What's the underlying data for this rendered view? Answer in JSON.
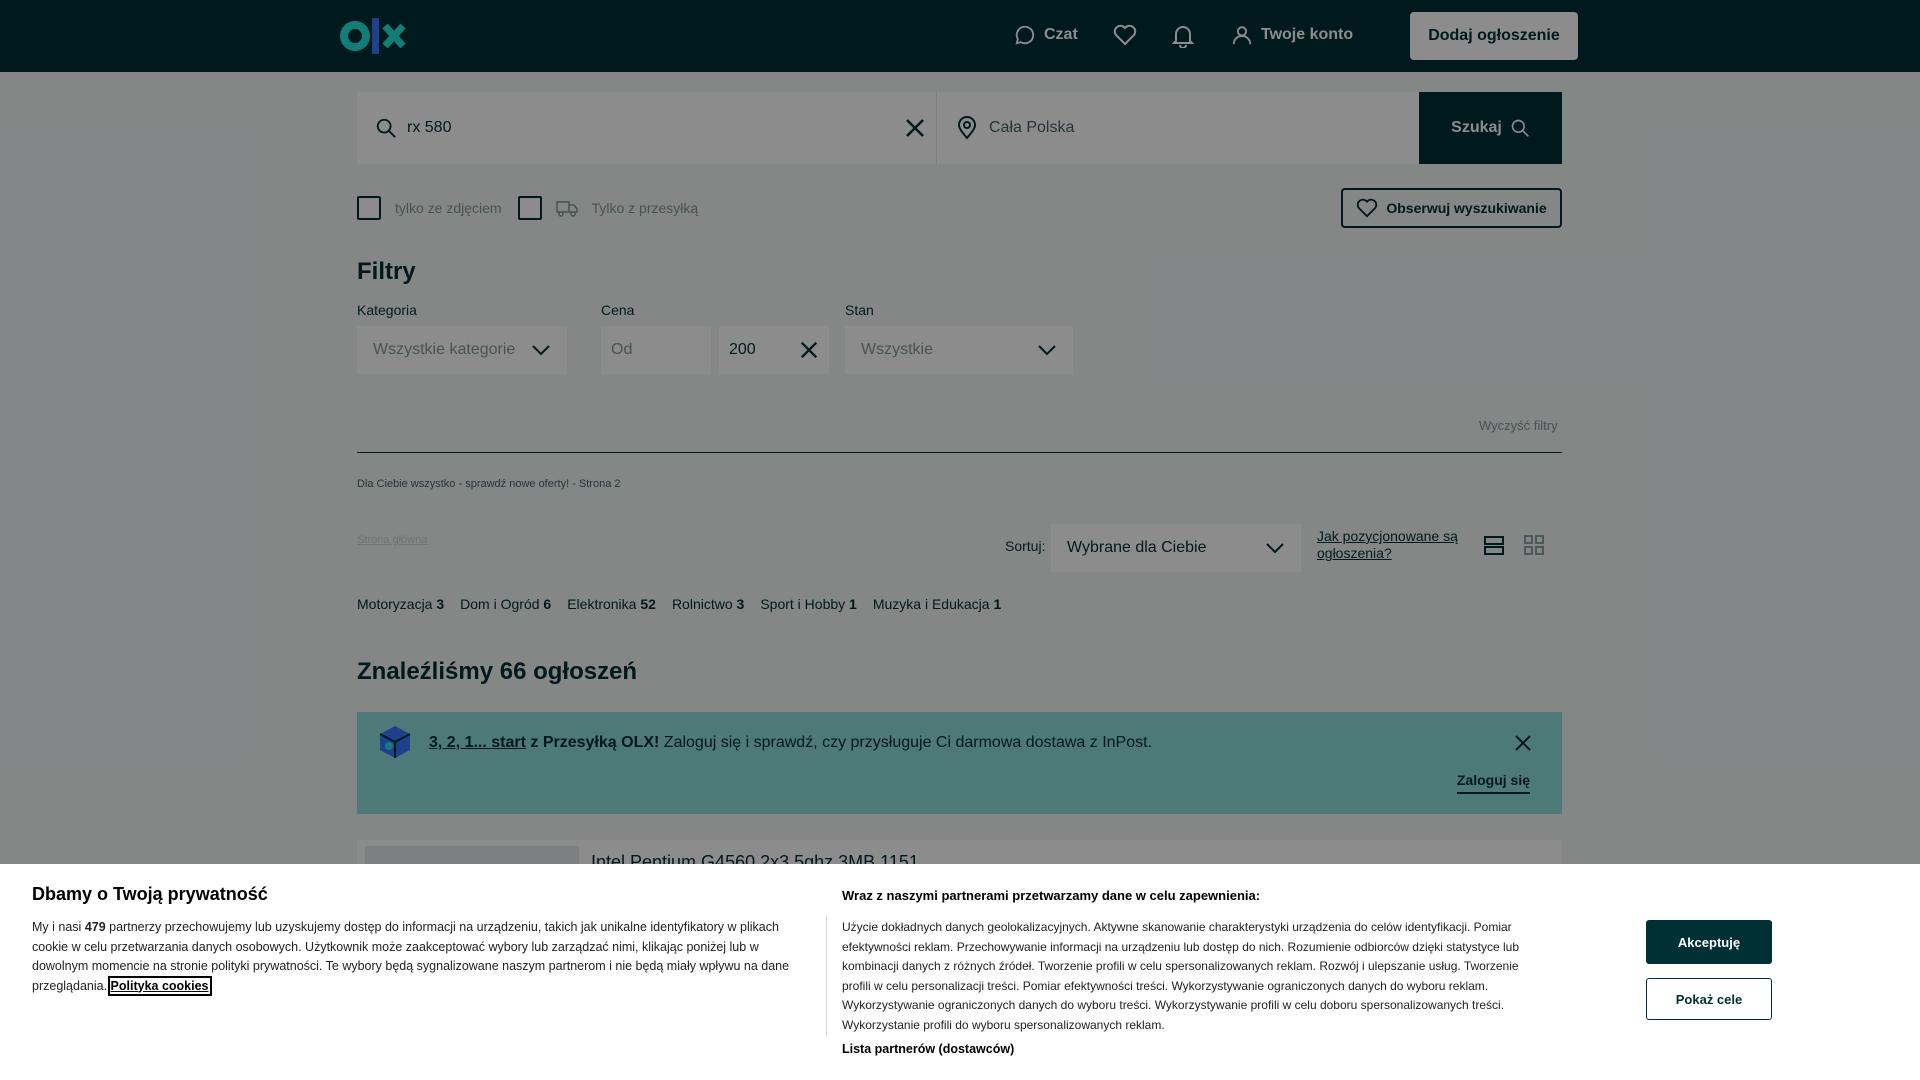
{
  "header": {
    "logo_text": "olx",
    "chat_label": "Czat",
    "account_label": "Twoje konto",
    "add_listing_label": "Dodaj ogłoszenie"
  },
  "search": {
    "query": "rx 580",
    "location": "Cała Polska",
    "button_label": "Szukaj"
  },
  "checkboxes": {
    "photo_only": "tylko ze zdjęciem",
    "shipping_only": "Tylko z przesyłką"
  },
  "observe_label": "Obserwuj wyszukiwanie",
  "filters": {
    "title": "Filtry",
    "category_label": "Kategoria",
    "category_value": "Wszystkie kategorie",
    "price_label": "Cena",
    "price_from_placeholder": "Od",
    "price_to_value": "200",
    "condition_label": "Stan",
    "condition_value": "Wszystkie",
    "clear_label": "Wyczyść filtry"
  },
  "breadcrumb_text": "Dla Ciebie wszystko - sprawdź nowe oferty! - Strona 2",
  "faint_link": "Strona główna",
  "sort": {
    "label": "Sortuj:",
    "value": "Wybrane dla Ciebie",
    "positioning_link": "Jak pozycjonowane są ogłoszenia?"
  },
  "categories": [
    {
      "name": "Motoryzacja",
      "count": "3"
    },
    {
      "name": "Dom i Ogród",
      "count": "6"
    },
    {
      "name": "Elektronika",
      "count": "52"
    },
    {
      "name": "Rolnictwo",
      "count": "3"
    },
    {
      "name": "Sport i Hobby",
      "count": "1"
    },
    {
      "name": "Muzyka i Edukacja",
      "count": "1"
    }
  ],
  "results_heading": "Znaleźliśmy 66 ogłoszeń",
  "promo": {
    "link": "3, 2, 1... start",
    "bold": "z Przesyłką OLX!",
    "text": "Zaloguj się i sprawdź, czy przysługuje Ci darmowa dostawa z InPost.",
    "login_label": "Zaloguj się"
  },
  "listing_peek_title": "Intel Pentium G4560 2x3,5ghz 3MB 1151",
  "cookie": {
    "title": "Dbamy o Twoją prywatność",
    "text_a": "My i nasi",
    "partners_count": "479",
    "text_b": "partnerzy przechowujemy lub uzyskujemy dostęp do informacji na urządzeniu, takich jak unikalne identyfikatory w plikach cookie w celu przetwarzania danych osobowych. Użytkownik może zaakceptować wybory lub zarządzać nimi, klikając poniżej lub w dowolnym momencie na stronie polityki prywatności. Te wybory będą sygnalizowane naszym partnerom i nie będą miały wpływu na dane przeglądania.",
    "policy_link": "Polityka cookies",
    "right_title": "Wraz z naszymi partnerami przetwarzamy dane w celu zapewnienia:",
    "right_text": "Użycie dokładnych danych geolokalizacyjnych. Aktywne skanowanie charakterystyki urządzenia do celów identyfikacji. Pomiar efektywności reklam. Przechowywanie informacji na urządzeniu lub dostęp do nich. Rozumienie odbiorców dzięki statystyce lub kombinacji danych z różnych źródeł. Tworzenie profili w celu spersonalizowanych reklam. Rozwój i ulepszanie usług. Tworzenie profili w celu personalizacji treści. Pomiar efektywności treści. Wykorzystywanie ograniczonych danych do wyboru reklam. Wykorzystywanie ograniczonych danych do wyboru treści. Wykorzystywanie profili w celu doboru spersonalizowanych treści. Wykorzystanie profili do wyboru spersonalizowanych reklam.",
    "partners_link": "Lista partnerów (dostawców)",
    "accept_label": "Akceptuję",
    "purposes_label": "Pokaż cele"
  }
}
